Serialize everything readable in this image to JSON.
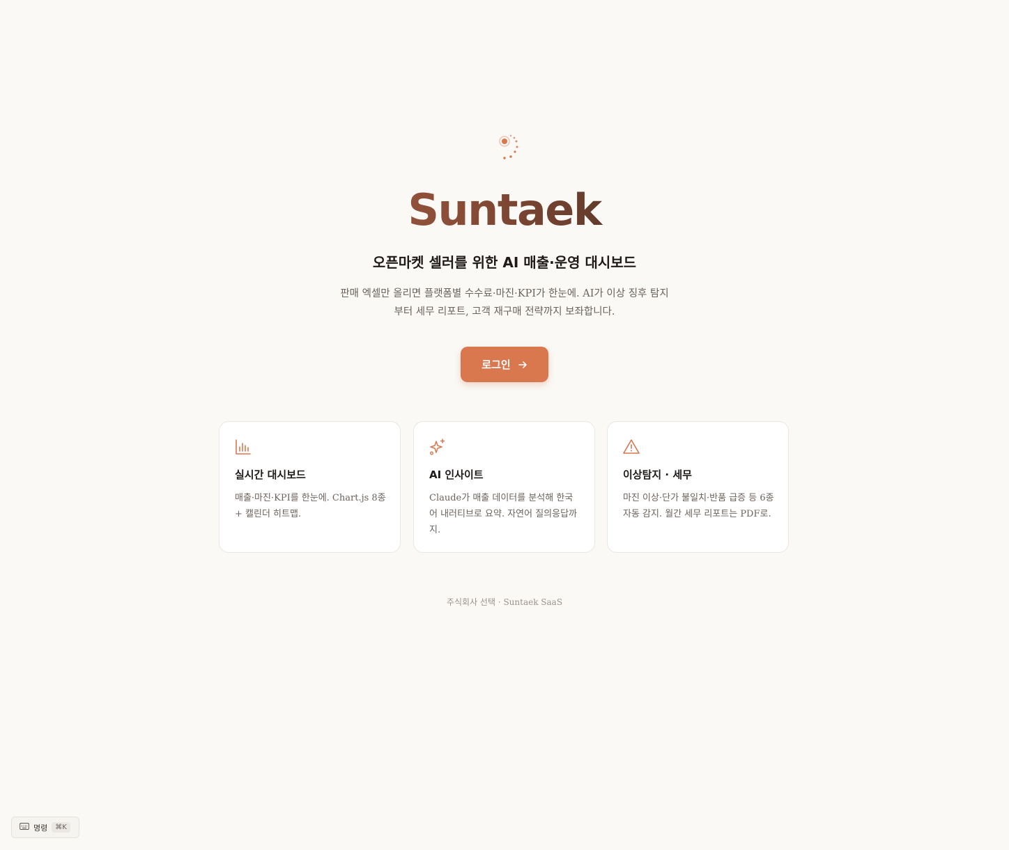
{
  "brand": {
    "logo_icon": "orbit-spinner-icon",
    "name": "Suntaek",
    "gradient_colors": [
      "#c9714f",
      "#8a4d37",
      "#2e221d",
      "#1d1916"
    ]
  },
  "hero": {
    "subtitle": "오픈마켓 셀러를 위한 AI 매출·운영 대시보드",
    "description": "판매 엑셀만 올리면 플랫폼별 수수료·마진·KPI가 한눈에. AI가 이상 징후 탐지부터 세무 리포트, 고객 재구매 전략까지 보좌합니다."
  },
  "login_button": {
    "label": "로그인",
    "icon": "arrow-right-icon",
    "color": "#d9774f"
  },
  "features": [
    {
      "icon": "bar-chart-icon",
      "title": "실시간 대시보드",
      "description": "매출·마진·KPI를 한눈에. Chart.js 8종 + 캘린더 히트맵."
    },
    {
      "icon": "sparkles-icon",
      "title": "AI 인사이트",
      "description": "Claude가 매출 데이터를 분석해 한국어 내러티브로 요약. 자연어 질의응답까지."
    },
    {
      "icon": "warning-triangle-icon",
      "title": "이상탐지 · 세무",
      "description": "마진 이상·단가 불일치·반품 급증 등 6종 자동 감지. 월간 세무 리포트는 PDF로."
    }
  ],
  "footer": {
    "text": "주식회사 선택 · Suntaek SaaS"
  },
  "command_palette": {
    "icon": "keyboard-icon",
    "label": "명령",
    "shortcut": "⌘K"
  },
  "accent_color": "#d9774f"
}
